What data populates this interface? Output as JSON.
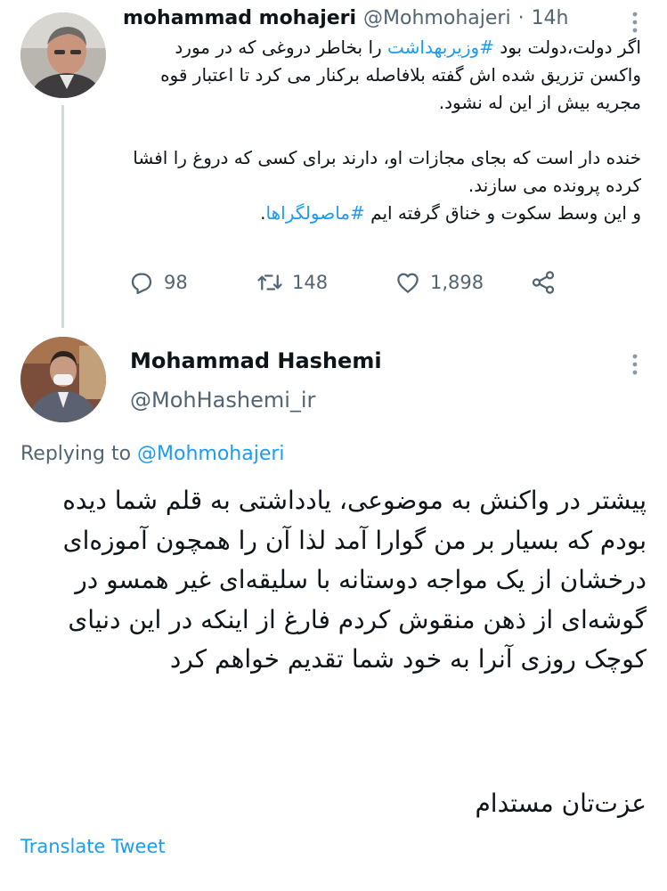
{
  "tweet1": {
    "display_name": "mohammad mohajeri",
    "handle": "@Mohmohajeri",
    "separator": "·",
    "time": "14h",
    "text_part1": "اگر دولت،دولت بود ",
    "hashtag1": "#وزیربهداشت",
    "text_part2": " را بخاطر دروغی که در مورد واکسن تزریق شده اش گفته بلافاصله برکنار می کرد تا اعتبار قوه مجریه بیش از این له نشود.",
    "paragraph2": "خنده دار است که بجای مجازات او، دارند برای کسی که دروغ را افشا کرده پرونده می سازند.",
    "text_part3": "و  این وسط سکوت و خناق گرفته ایم ",
    "hashtag2": "#ماصولگراها",
    "text_part4": ".",
    "replies": "98",
    "retweets": "148",
    "likes": "1,898"
  },
  "tweet2": {
    "display_name": "Mohammad Hashemi",
    "handle": "@MohHashemi_ir",
    "replying_prefix": "Replying to ",
    "replying_handle": "@Mohmohajeri",
    "text": "پیشتر در واکنش به موضوعی، یادداشتی به قلم شما دیده بودم که بسیار بر من گوارا آمد لذا آن را همچون آموزه‌ای درخشان از یک مواجه دوستانه با سلیقه‌ای غیر همسو در گوشه‌ای از ذهن منقوش کردم فارغ از اینکه در این دنیای کوچک روزی آنرا به خود شما تقدیم خواهم کرد",
    "signoff": "عزت‌تان مستدام",
    "translate_label": "Translate Tweet"
  },
  "colors": {
    "accent": "#1d9bf0",
    "secondary_text": "#536471",
    "thread_line": "#cfd9de"
  },
  "icons": [
    "reply-icon",
    "retweet-icon",
    "like-icon",
    "share-icon",
    "more-icon"
  ]
}
